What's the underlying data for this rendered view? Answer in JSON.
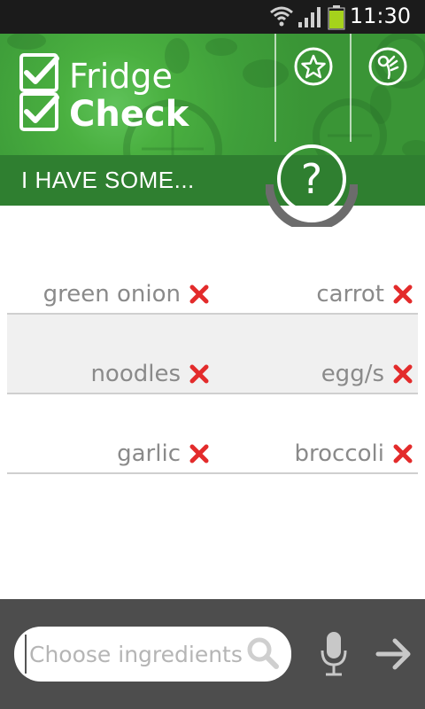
{
  "status_bar": {
    "time": "11:30"
  },
  "app": {
    "name_line1": "Fridge",
    "name_line2": "Check"
  },
  "header": {
    "banner_text": "I HAVE SOME...",
    "help_symbol": "?",
    "page_dots": {
      "count": 4,
      "active": 1
    }
  },
  "ingredients": [
    [
      "green onion",
      "carrot"
    ],
    [
      "noodles",
      "egg/s"
    ],
    [
      "garlic",
      "broccoli"
    ]
  ],
  "bottom_bar": {
    "search_placeholder": "Choose ingredients",
    "search_value": ""
  },
  "icons": {
    "favorites": "star-icon",
    "ok_hand": "ok-hand-icon",
    "help": "question-icon",
    "remove": "close-x-icon",
    "search": "search-icon",
    "mic": "microphone-icon",
    "submit": "arrow-right-icon"
  },
  "colors": {
    "brand_green": "#4ab040",
    "banner_green": "#2f7f30",
    "remove_red": "#e32b2b",
    "bottom_bar": "#4d4d4d"
  }
}
